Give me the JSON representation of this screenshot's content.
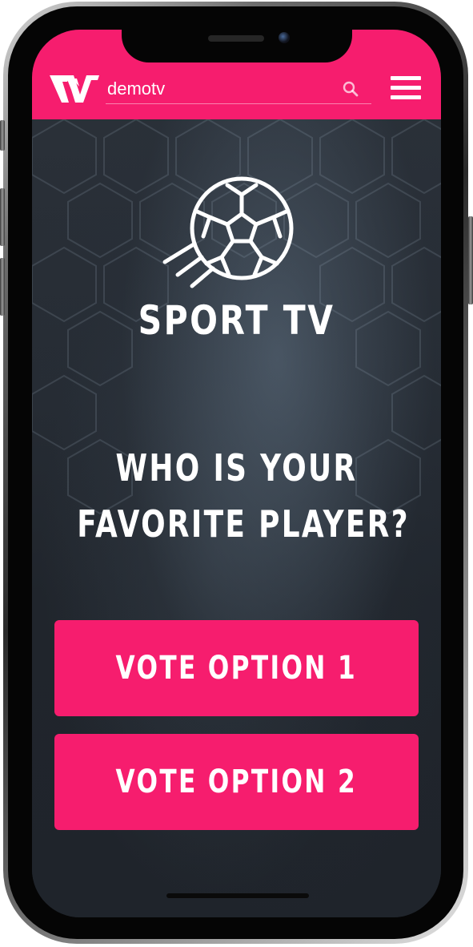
{
  "header": {
    "logo_icon": "tw-logo-icon",
    "search": {
      "value": "",
      "placeholder": "demotv",
      "icon": "search-icon"
    },
    "menu_icon": "hamburger-menu-icon",
    "background_color": "#f61d6e"
  },
  "hero": {
    "emblem_icon": "soccer-ball-icon",
    "brand_title": "SPORT TV"
  },
  "poll": {
    "question_line1": "WHO IS YOUR",
    "question_line2": "FAVORITE PLAYER?",
    "options": [
      {
        "label": "VOTE OPTION 1"
      },
      {
        "label": "VOTE OPTION 2"
      }
    ]
  },
  "colors": {
    "accent": "#f61d6e",
    "background": "#1f242b",
    "text": "#ffffff"
  }
}
